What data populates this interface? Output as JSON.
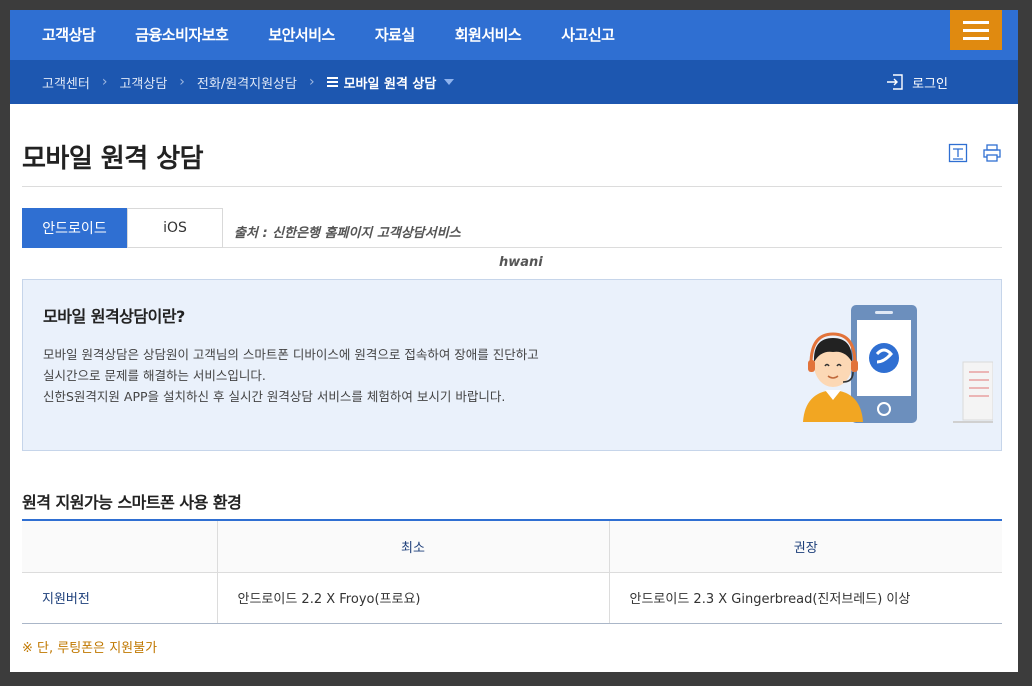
{
  "top_nav": {
    "items": [
      "고객상담",
      "금융소비자보호",
      "보안서비스",
      "자료실",
      "회원서비스",
      "사고신고"
    ]
  },
  "breadcrumb": {
    "items": [
      "고객센터",
      "고객상담",
      "전화/원격지원상담"
    ],
    "current": "모바일 원격 상담",
    "login": "로그인"
  },
  "page": {
    "title": "모바일 원격 상담"
  },
  "tabs": [
    {
      "label": "안드로이드",
      "selected": true
    },
    {
      "label": "iOS",
      "selected": false
    }
  ],
  "source_note": "출처 : 신한은행 홈페이지 고객상담서비스",
  "watermark": "hwani",
  "info": {
    "heading": "모바일 원격상담이란?",
    "lines": [
      "모바일 원격상담은 상담원이 고객님의 스마트폰 디바이스에 원격으로 접속하여 장애를 진단하고",
      "실시간으로 문제를 해결하는 서비스입니다.",
      "신한S원격지원 APP을 설치하신 후 실시간 원격상담 서비스를 체험하여 보시기 바랍니다."
    ]
  },
  "spec": {
    "heading": "원격 지원가능 스마트폰 사용 환경",
    "columns": [
      "",
      "최소",
      "권장"
    ],
    "rows": [
      [
        "지원버전",
        "안드로이드 2.2 X Froyo(프로요)",
        "안드로이드 2.3 X Gingerbread(진저브레드) 이상"
      ]
    ]
  },
  "footnote": "※ 단, 루팅폰은 지원불가",
  "colors": {
    "primary": "#2f6fd2",
    "breadcrumb_bg": "#1d57b0",
    "menu_button": "#e08a10",
    "info_bg": "#eaf1fb",
    "note": "#c07800"
  },
  "icons": [
    "hamburger-icon",
    "login-icon",
    "font-size-icon",
    "print-icon",
    "chevron-right-icon",
    "menu-list-icon",
    "caret-down-icon"
  ]
}
